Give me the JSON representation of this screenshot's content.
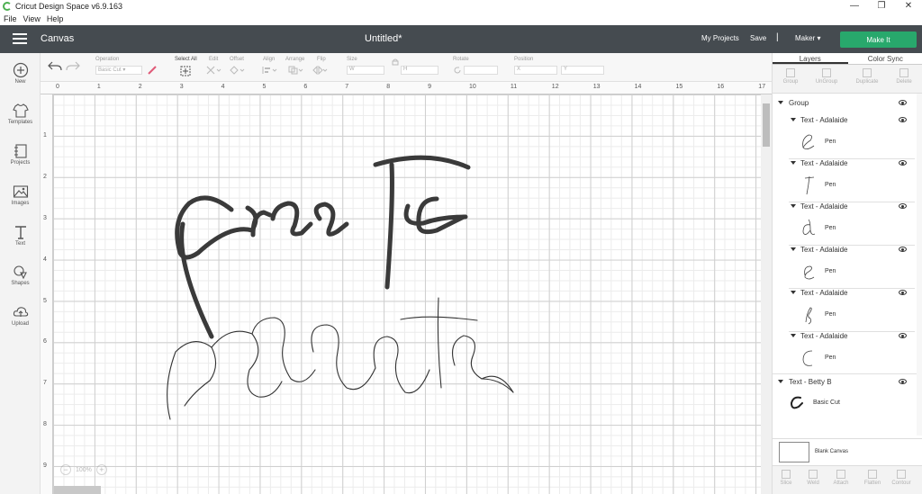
{
  "app": {
    "title": "Cricut Design Space  v6.9.163"
  },
  "window": {
    "minimize": "—",
    "restore": "❐",
    "close": "✕"
  },
  "menu": [
    "File",
    "View",
    "Help"
  ],
  "header": {
    "canvas_label": "Canvas",
    "doc_title": "Untitled*",
    "my_projects": "My Projects",
    "save": "Save",
    "separator": "|",
    "machine": "Maker",
    "make_it": "Make It"
  },
  "left_bar": [
    {
      "label": "New",
      "icon": "plus-circle-icon"
    },
    {
      "label": "Templates",
      "icon": "shirt-icon"
    },
    {
      "label": "Projects",
      "icon": "notebook-icon"
    },
    {
      "label": "Images",
      "icon": "image-icon"
    },
    {
      "label": "Text",
      "icon": "text-icon"
    },
    {
      "label": "Shapes",
      "icon": "shapes-icon"
    },
    {
      "label": "Upload",
      "icon": "cloud-upload-icon"
    }
  ],
  "edit_bar": {
    "operation_label": "Operation",
    "operation_value": "Basic Cut",
    "select_all": "Select All",
    "edit": "Edit",
    "offset": "Offset",
    "align": "Align",
    "arrange": "Arrange",
    "flip": "Flip",
    "size": "Size",
    "size_w": "W",
    "size_h": "H",
    "rotate": "Rotate",
    "position": "Position",
    "pos_x": "X",
    "pos_y": "Y"
  },
  "ruler": {
    "top": [
      "0",
      "1",
      "2",
      "3",
      "4",
      "5",
      "6",
      "7",
      "8",
      "9",
      "10",
      "11",
      "12",
      "13",
      "14",
      "15",
      "16",
      "17"
    ],
    "left": [
      "1",
      "2",
      "3",
      "4",
      "5",
      "6",
      "7",
      "8",
      "9"
    ]
  },
  "zoom": {
    "minus": "−",
    "level": "100%",
    "plus": "+"
  },
  "right_panel": {
    "tabs": [
      "Layers",
      "Color Sync"
    ],
    "tools": [
      "Group",
      "UnGroup",
      "Duplicate",
      "Delete"
    ],
    "group_name": "Group",
    "layers": [
      {
        "name": "Text - Adalaide",
        "sub": "Pen",
        "letter": "e"
      },
      {
        "name": "Text - Adalaide",
        "sub": "Pen",
        "letter": "t"
      },
      {
        "name": "Text - Adalaide",
        "sub": "Pen",
        "letter": "a"
      },
      {
        "name": "Text - Adalaide",
        "sub": "Pen",
        "letter": "e"
      },
      {
        "name": "Text - Adalaide",
        "sub": "Pen",
        "letter": "r"
      },
      {
        "name": "Text - Adalaide",
        "sub": "Pen",
        "letter": "c"
      }
    ],
    "betty": {
      "name": "Text - Betty B",
      "sub": "Basic Cut"
    },
    "blank_canvas": "Blank Canvas",
    "bottom_tools": [
      "Slice",
      "Weld",
      "Attach",
      "Flatten",
      "Contour"
    ]
  },
  "colors": {
    "header": "#454b50",
    "make_it": "#28a86c"
  }
}
